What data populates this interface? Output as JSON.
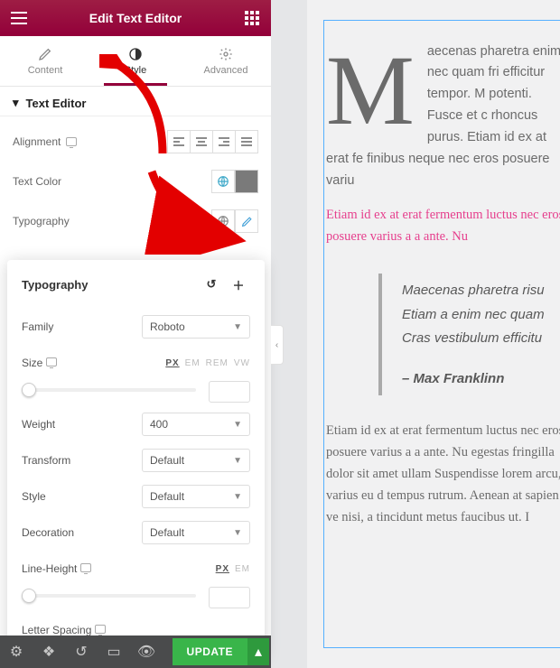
{
  "header": {
    "title": "Edit Text Editor"
  },
  "tabs": {
    "content": "Content",
    "style": "Style",
    "advanced": "Advanced"
  },
  "section": {
    "title": "Text Editor"
  },
  "controls": {
    "alignment": "Alignment",
    "textcolor": "Text Color",
    "typography": "Typography"
  },
  "pop": {
    "title": "Typography",
    "family_lbl": "Family",
    "family_val": "Roboto",
    "size_lbl": "Size",
    "weight_lbl": "Weight",
    "weight_val": "400",
    "transform_lbl": "Transform",
    "transform_val": "Default",
    "style_lbl": "Style",
    "style_val": "Default",
    "decoration_lbl": "Decoration",
    "decoration_val": "Default",
    "lineheight_lbl": "Line-Height",
    "letterspacing_lbl": "Letter Spacing",
    "units_size": {
      "px": "PX",
      "em": "EM",
      "rem": "REM",
      "vw": "VW"
    },
    "units_lh": {
      "px": "PX",
      "em": "EM"
    }
  },
  "footer": {
    "update": "UPDATE"
  },
  "preview": {
    "dropcap": "M",
    "p1": "aecenas pharetra enim nec quam fri efficitur tempor. M potenti. Fusce et c rhoncus purus. Etiam id ex at erat fe finibus neque nec eros posuere variu",
    "p2": "Etiam id ex at erat fermentum luctus nec eros posuere varius a a ante. Nu",
    "quote": "Maecenas pharetra risu Etiam a enim nec quam  Cras vestibulum efficitu",
    "author": "– Max Franklinn",
    "p3": "Etiam id ex at erat fermentum luctus nec eros posuere varius a a ante. Nu egestas fringilla dolor sit amet ullam Suspendisse lorem arcu, varius eu d tempus rutrum. Aenean at sapien ve nisi, a tincidunt metus faucibus ut. I"
  }
}
